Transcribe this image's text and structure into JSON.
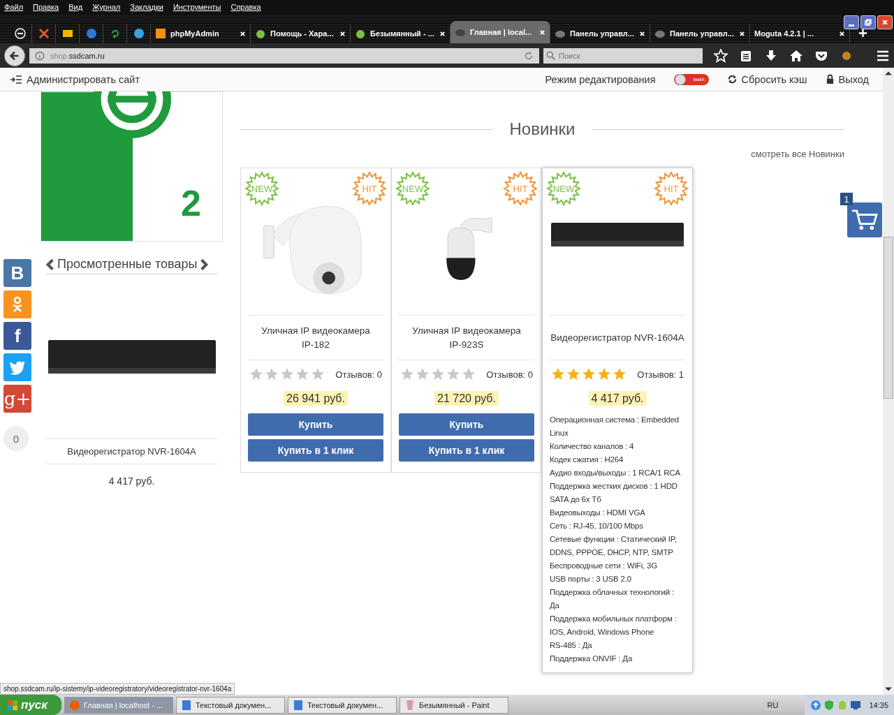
{
  "menu_bar": [
    "Файл",
    "Правка",
    "Вид",
    "Журнал",
    "Закладки",
    "Инструменты",
    "Справка"
  ],
  "tabs": [
    {
      "kind": "pinned",
      "selected": false
    },
    {
      "kind": "pinned",
      "selected": false
    },
    {
      "kind": "pinned",
      "selected": false
    },
    {
      "kind": "pinned",
      "selected": false
    },
    {
      "kind": "pinned",
      "selected": false
    },
    {
      "kind": "pinned",
      "selected": false
    },
    {
      "kind": "page",
      "label": "phpMyAdmin",
      "selected": false
    },
    {
      "kind": "page",
      "label": "Помощь - Хара...",
      "selected": false
    },
    {
      "kind": "page",
      "label": "Безымянный - ...",
      "selected": false
    },
    {
      "kind": "page",
      "label": "Главная | local...",
      "selected": true
    },
    {
      "kind": "page",
      "label": "Панель управл...",
      "selected": false
    },
    {
      "kind": "page",
      "label": "Панель управл...",
      "selected": false
    },
    {
      "kind": "page",
      "label": "Moguta 4.2.1 | ...",
      "selected": false
    }
  ],
  "address_bar": {
    "host_prefix": "shop.",
    "host": "ssdcam.ru"
  },
  "search": {
    "placeholder": "Поиск"
  },
  "admin_bar": {
    "admin_link": "Администрировать сайт",
    "edit_mode_label": "Режим редактирования",
    "edit_mode": {
      "on": false,
      "label": "выкл."
    },
    "clear_cache": "Сбросить кэш",
    "logout": "Выход"
  },
  "sidebar": {
    "banner_number": "2",
    "viewed_title": "Просмотренные товары",
    "viewed_product": {
      "name": "Видеорегистратор NVR-1604A",
      "price": "4 417 руб."
    }
  },
  "social": {
    "buttons": [
      {
        "kind": "vk",
        "label": "B",
        "color": "#4a76a8"
      },
      {
        "kind": "ok",
        "color": "#f7931e"
      },
      {
        "kind": "fb",
        "label": "f",
        "color": "#3b5998"
      },
      {
        "kind": "tw",
        "color": "#1da1f2"
      },
      {
        "kind": "gp",
        "label": "g+",
        "color": "#d34836"
      }
    ],
    "count": "0"
  },
  "section": {
    "title": "Новинки",
    "view_all": "смотреть все Новинки"
  },
  "products": [
    {
      "new_badge": "NEW",
      "hit_badge": "HIT",
      "kind": "dome",
      "name": [
        "Уличная IP видеокамера",
        "IP-182"
      ],
      "stars": 0,
      "reviews": "Отзывов: 0",
      "price": "26 941 руб.",
      "buttons": [
        "Купить",
        "Купить в 1 клик"
      ],
      "hovered": false
    },
    {
      "new_badge": "NEW",
      "hit_badge": "HIT",
      "kind": "ptz",
      "name": [
        "Уличная IP видеокамера",
        "IP-923S"
      ],
      "stars": 0,
      "reviews": "Отзывов: 0",
      "price": "21 720 руб.",
      "buttons": [
        "Купить",
        "Купить в 1 клик"
      ],
      "hovered": false
    },
    {
      "new_badge": "NEW",
      "hit_badge": "HIT",
      "kind": "recorder",
      "name": [
        "Видеорегистратор NVR-1604A"
      ],
      "stars": 5,
      "reviews": "Отзывов: 1",
      "price": "4 417 руб.",
      "hovered": true,
      "specs": [
        "Операционная система : Embedded Linux",
        "Количество каналов : 4",
        "Кодек сжатия : H264",
        "Аудио входы/выходы : 1 RCA/1 RCA",
        "Поддержка жестких дисков : 1 HDD SATA до 6х Тб",
        "Видеовыходы : HDMI VGA",
        "Сеть : RJ-45, 10/100 Mbps",
        "Сетевые функции : Статический IP, DDNS, PPPOE, DHCP, NTP, SMTP",
        "Беспроводные сети : WiFi, 3G",
        "USB порты : 3 USB 2.0",
        "Поддержка облачных технологий : Да",
        "Поддержка мобильных платформ : IOS, Android, Windows Phone",
        "RS-485 : Да",
        "Поддержка ONVIF : Да"
      ]
    }
  ],
  "cart": {
    "count": "1"
  },
  "status_url": "shop.ssdcam.ru/ip-sistemy/ip-videoregistratory/videoregistrator-nvr-1604a",
  "taskbar": {
    "start": "пуск",
    "tasks": [
      {
        "label": "Главная | localhost - ...",
        "selected": true
      },
      {
        "label": "Текстовый докумен...",
        "selected": false
      },
      {
        "label": "Текстовый докумен...",
        "selected": false
      },
      {
        "label": "Безымянный - Paint",
        "selected": false
      }
    ],
    "language": "RU",
    "clock": "14:35"
  }
}
